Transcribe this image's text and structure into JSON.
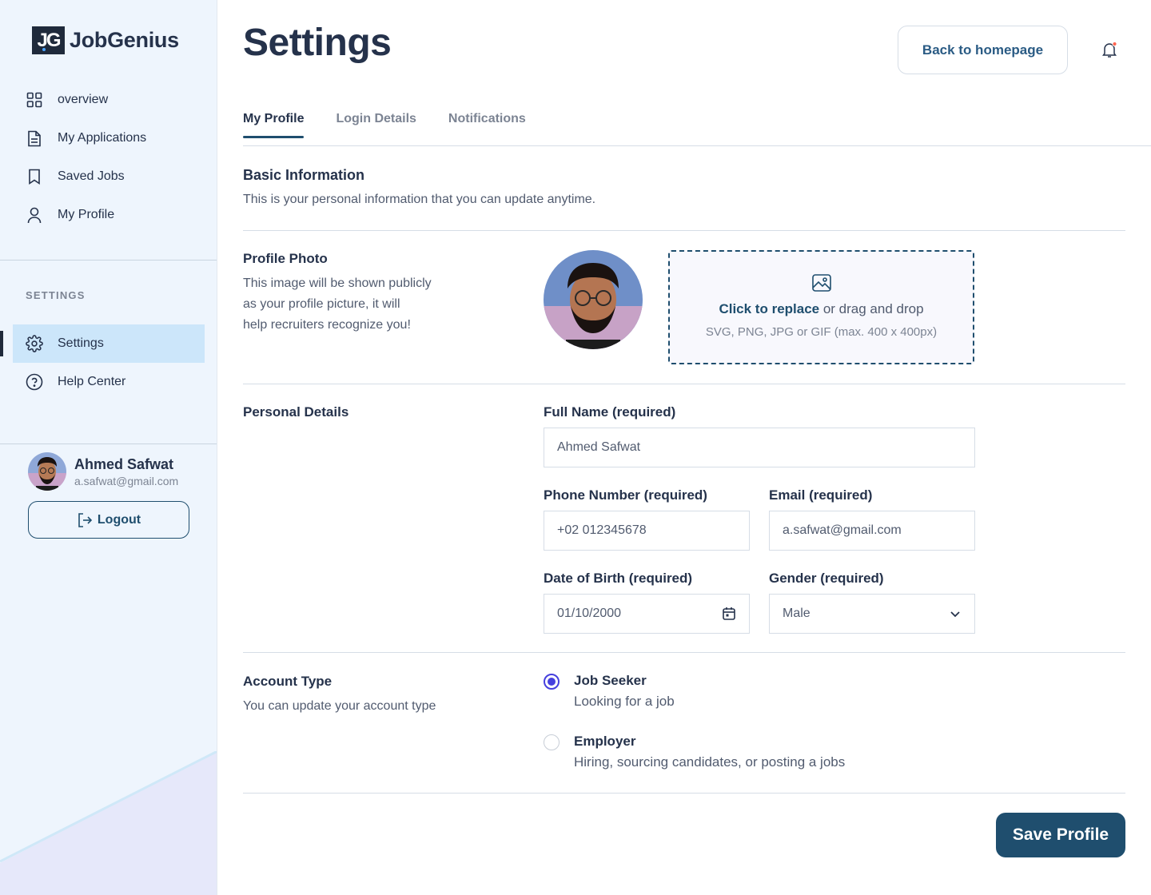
{
  "brand": {
    "logo_mark": "JG",
    "name": "JobGenius"
  },
  "sidebar": {
    "main_items": [
      {
        "label": "overview",
        "icon": "grid-icon"
      },
      {
        "label": "My Applications",
        "icon": "document-icon"
      },
      {
        "label": "Saved Jobs",
        "icon": "bookmark-icon"
      },
      {
        "label": "My Profile",
        "icon": "user-icon"
      }
    ],
    "settings_heading": "SETTINGS",
    "settings_items": [
      {
        "label": "Settings",
        "icon": "gear-icon",
        "active": true
      },
      {
        "label": "Help Center",
        "icon": "help-circle-icon"
      }
    ],
    "user": {
      "name": "Ahmed Safwat",
      "email": "a.safwat@gmail.com"
    },
    "logout_label": "Logout"
  },
  "header": {
    "title": "Settings",
    "back_label": "Back to homepage"
  },
  "tabs": [
    {
      "label": "My Profile",
      "active": true
    },
    {
      "label": "Login Details",
      "active": false
    },
    {
      "label": "Notifications",
      "active": false
    }
  ],
  "basic_info": {
    "title": "Basic Information",
    "subtitle": "This is your personal information that you can update anytime."
  },
  "profile_photo": {
    "title": "Profile Photo",
    "description": [
      "This image will be shown publicly",
      "as your profile picture, it will",
      "help recruiters recognize you!"
    ],
    "upload_link": "Click to replace",
    "upload_text": " or drag and drop",
    "upload_hint": "SVG, PNG, JPG or GIF (max. 400 x 400px)"
  },
  "personal_details": {
    "title": "Personal Details",
    "full_name": {
      "label": "Full Name (required)",
      "value": "Ahmed Safwat"
    },
    "phone": {
      "label": "Phone Number (required)",
      "value": "+02 012345678"
    },
    "email": {
      "label": "Email (required)",
      "value": "a.safwat@gmail.com"
    },
    "dob": {
      "label": "Date of Birth (required)",
      "value": "01/10/2000"
    },
    "gender": {
      "label": "Gender (required)",
      "value": "Male"
    }
  },
  "account_type": {
    "title": "Account Type",
    "subtitle": "You can update your account type",
    "options": [
      {
        "title": "Job Seeker",
        "subtitle": "Looking for a job",
        "checked": true
      },
      {
        "title": "Employer",
        "subtitle": "Hiring, sourcing candidates, or posting a jobs",
        "checked": false
      }
    ]
  },
  "save_label": "Save Profile",
  "colors": {
    "primary": "#1f4e6e",
    "accent": "#4640de",
    "sidebar_bg": "#eef5fd",
    "active_nav": "#cce6fa",
    "notification_dot": "#ff6550"
  }
}
